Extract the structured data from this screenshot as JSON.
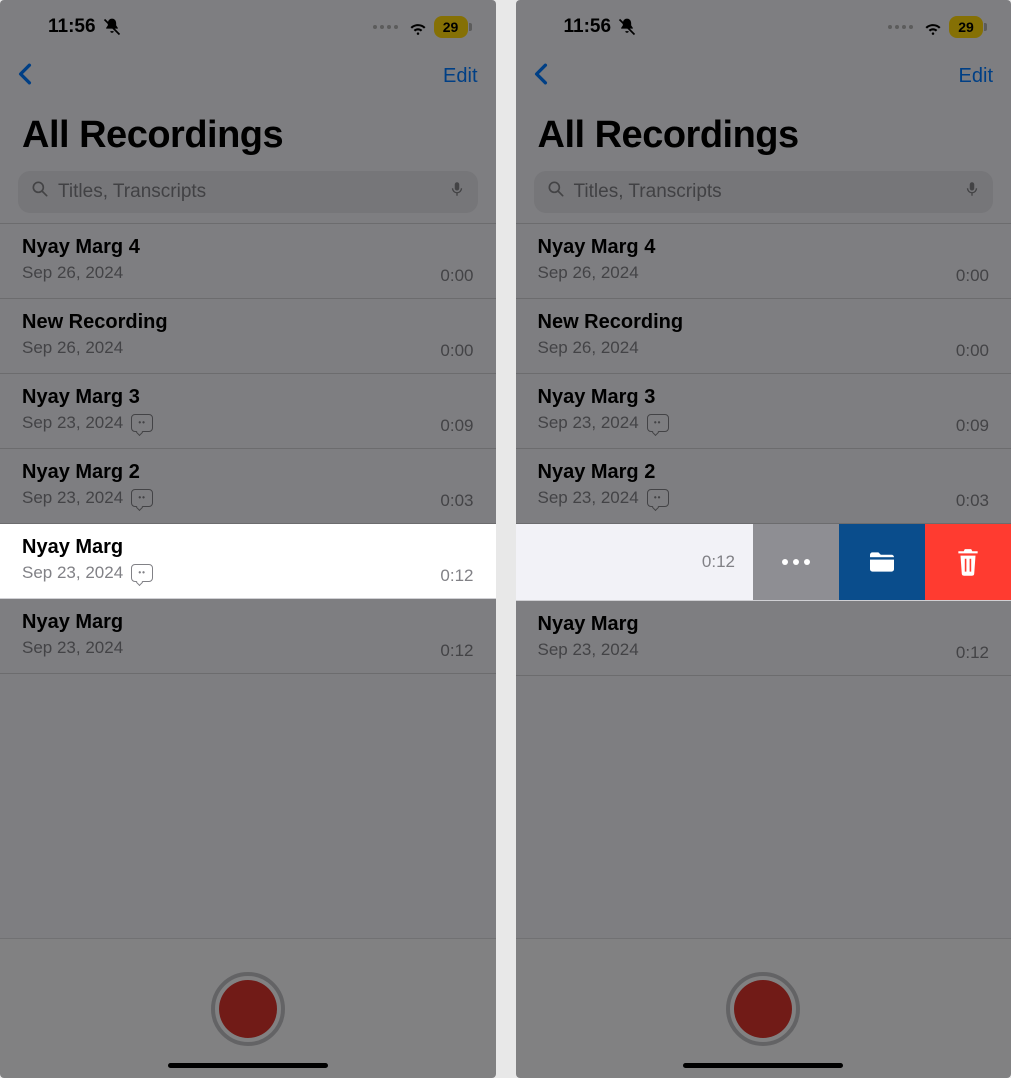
{
  "status": {
    "time": "11:56",
    "battery": "29"
  },
  "nav": {
    "edit": "Edit"
  },
  "header": {
    "title": "All Recordings"
  },
  "search": {
    "placeholder": "Titles, Transcripts"
  },
  "left": {
    "rows": [
      {
        "title": "Nyay Marg 4",
        "date": "Sep 26, 2024",
        "dur": "0:00",
        "transcript": false
      },
      {
        "title": "New Recording",
        "date": "Sep 26, 2024",
        "dur": "0:00",
        "transcript": false
      },
      {
        "title": "Nyay Marg 3",
        "date": "Sep 23, 2024",
        "dur": "0:09",
        "transcript": true
      },
      {
        "title": "Nyay Marg 2",
        "date": "Sep 23, 2024",
        "dur": "0:03",
        "transcript": true
      },
      {
        "title": "Nyay Marg",
        "date": "Sep 23, 2024",
        "dur": "0:12",
        "transcript": true,
        "highlight": true
      },
      {
        "title": "Nyay Marg",
        "date": "Sep 23, 2024",
        "dur": "0:12",
        "transcript": false
      }
    ]
  },
  "right": {
    "rows_top": [
      {
        "title": "Nyay Marg 4",
        "date": "Sep 26, 2024",
        "dur": "0:00",
        "transcript": false
      },
      {
        "title": "New Recording",
        "date": "Sep 26, 2024",
        "dur": "0:00",
        "transcript": false
      },
      {
        "title": "Nyay Marg 3",
        "date": "Sep 23, 2024",
        "dur": "0:09",
        "transcript": true
      },
      {
        "title": "Nyay Marg 2",
        "date": "Sep 23, 2024",
        "dur": "0:03",
        "transcript": true
      }
    ],
    "swiped": {
      "dur": "0:12"
    },
    "rows_bottom": [
      {
        "title": "Nyay Marg",
        "date": "Sep 23, 2024",
        "dur": "0:12",
        "transcript": false
      }
    ]
  }
}
